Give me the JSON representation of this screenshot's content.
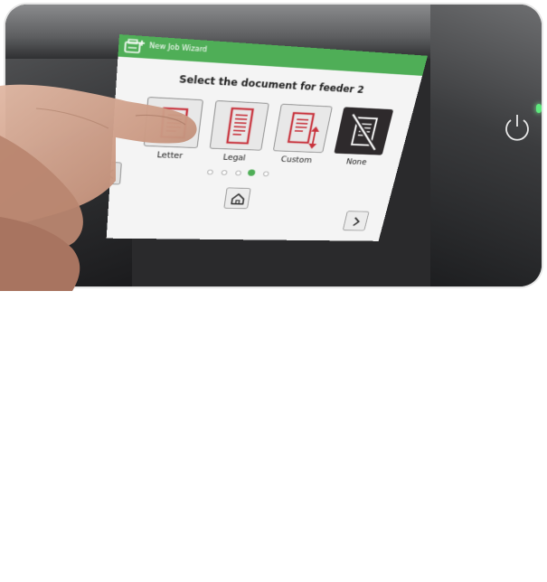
{
  "window": {
    "title": "New Job Wizard",
    "title_icon": "scanner-add-icon"
  },
  "prompt": "Select the document for feeder 2",
  "options": [
    {
      "label": "Letter",
      "icon": "letter-document-icon"
    },
    {
      "label": "Legal",
      "icon": "legal-document-icon"
    },
    {
      "label": "Custom",
      "icon": "custom-document-icon"
    },
    {
      "label": "None",
      "icon": "no-document-icon"
    }
  ],
  "pagination": {
    "total_pages": 5,
    "current_page": 4
  },
  "controls": {
    "home_icon": "home-icon",
    "next_icon": "chevron-right-icon",
    "prev_icon": "chevron-left-icon",
    "power_icon": "power-icon"
  },
  "colors": {
    "accent": "#4fae57",
    "selected_tile": "#2e2a2c",
    "document_red": "#c8323c"
  }
}
